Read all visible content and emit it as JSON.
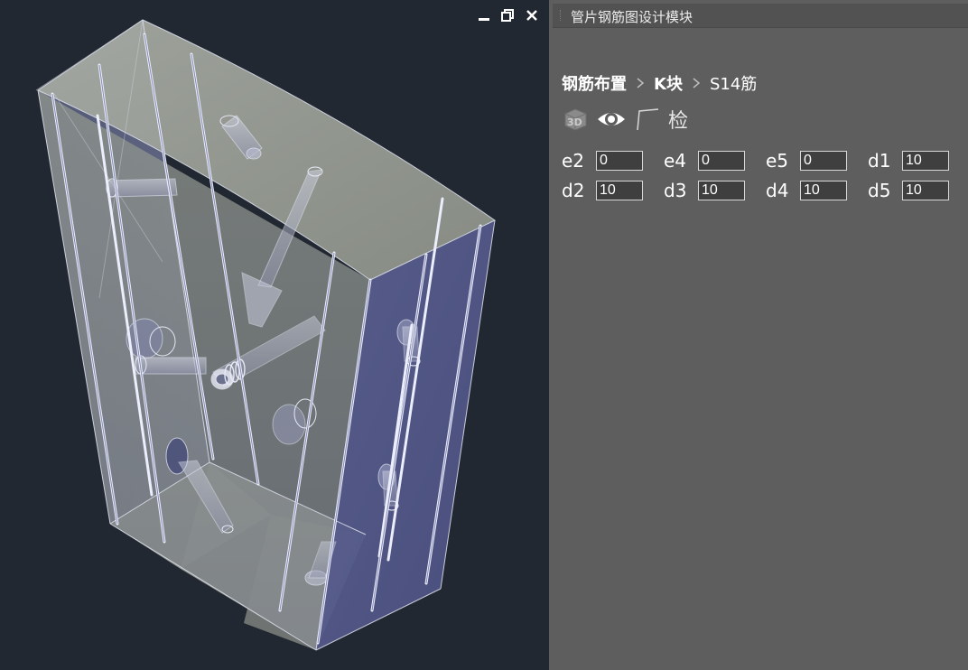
{
  "panel": {
    "title": "管片钢筋图设计模块",
    "breadcrumb": [
      {
        "label": "钢筋布置",
        "strong": true
      },
      {
        "label": "K块",
        "strong": true
      },
      {
        "label": "S14筋",
        "strong": false
      }
    ],
    "toolbar": [
      {
        "name": "view-3d-icon",
        "label": ""
      },
      {
        "name": "eye-icon",
        "label": ""
      },
      {
        "name": "section-icon",
        "label": ""
      },
      {
        "name": "check-button",
        "label": "检"
      }
    ],
    "params": [
      {
        "label": "e2",
        "value": "0"
      },
      {
        "label": "e4",
        "value": "0"
      },
      {
        "label": "e5",
        "value": "0"
      },
      {
        "label": "d1",
        "value": "10"
      },
      {
        "label": "d2",
        "value": "10"
      },
      {
        "label": "d3",
        "value": "10"
      },
      {
        "label": "d4",
        "value": "10"
      },
      {
        "label": "d5",
        "value": "10"
      }
    ]
  },
  "viewport": {
    "controls": [
      "minimize-icon",
      "restore-icon",
      "close-icon"
    ]
  },
  "colors": {
    "viewport_bg": "#222831",
    "panel_bg": "#5e5e5e",
    "block_face": "#9ea39b",
    "side_face": "#5f6493",
    "rebar": "#e6e8ff"
  }
}
